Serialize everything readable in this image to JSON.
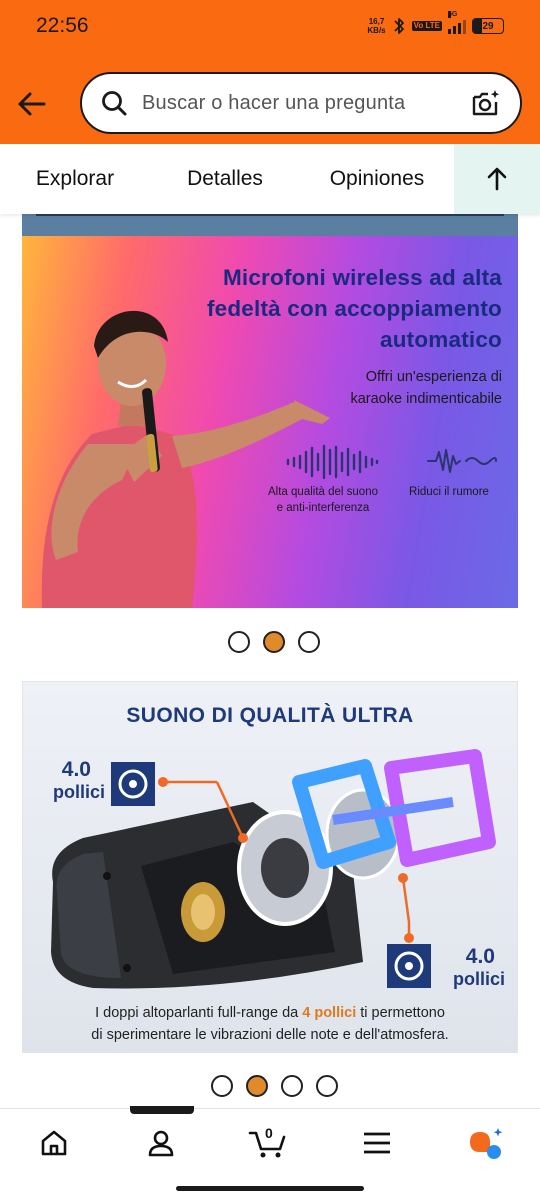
{
  "status_bar": {
    "time": "22:56",
    "net_speed_value": "16,7",
    "net_speed_unit": "KB/s",
    "volte_label": "Vo LTE",
    "signal_label": "5G",
    "battery_level": "29"
  },
  "header": {
    "search_placeholder": "Buscar o hacer una pregunta"
  },
  "tabs": [
    {
      "label": "Explorar"
    },
    {
      "label": "Detalles"
    },
    {
      "label": "Opiniones"
    }
  ],
  "carousel1": {
    "title": "Microfoni wireless ad alta fedeltà con accoppiamento automatico",
    "title_lines": [
      "Microfoni wireless ad alta",
      "fedeltà con accoppiamento",
      "automatico"
    ],
    "subtitle_lines": [
      "Offri un'esperienza di",
      "karaoke indimenticabile"
    ],
    "feature1_lines": [
      "Alta qualità del suono",
      "e anti-interferenza"
    ],
    "feature2": "Riduci il rumore",
    "dot_count": 3,
    "active_index": 1
  },
  "carousel2": {
    "title": "SUONO DI QUALITÀ ULTRA",
    "size_left_value": "4.0",
    "size_left_unit": "pollici",
    "size_right_value": "4.0",
    "size_right_unit": "pollici",
    "desc_line1_pre": "I doppi altoparlanti full-range da ",
    "desc_line1_hl": "4 pollici",
    "desc_line1_post": " ti permettono",
    "desc_line2": "di sperimentare le vibrazioni delle note e dell'atmosfera.",
    "dot_count": 4,
    "active_index": 1
  },
  "bottom_nav": {
    "items": [
      "home-icon",
      "profile-icon",
      "cart-icon",
      "menu-icon",
      "rufus-ai-icon"
    ],
    "cart_count": "0"
  },
  "colors": {
    "header_bg": "#fa6a10",
    "dot_active": "#e08a2c",
    "tab_up_bg": "#e4f4f1",
    "title_blue": "#1e3a7a",
    "accent_orange": "#e07a1c"
  }
}
